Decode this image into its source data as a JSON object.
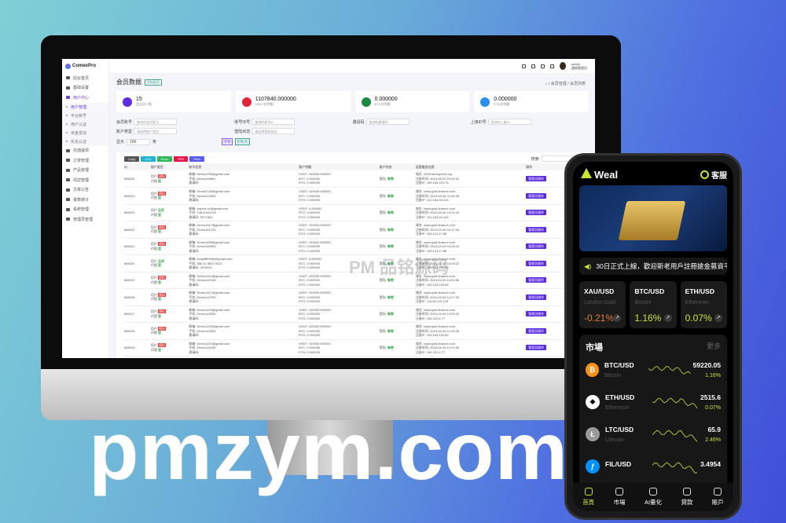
{
  "watermark": "pmzym.com",
  "admin": {
    "logo": "ComexPro",
    "sidebar": [
      {
        "label": "后台首页"
      },
      {
        "label": "基础设置"
      },
      {
        "label": "用户中心",
        "active": true,
        "children": [
          "用户管理",
          "平台账号",
          "用户认证",
          "资金变动",
          "实名认证"
        ]
      },
      {
        "label": "充值提现"
      },
      {
        "label": "订单管理"
      },
      {
        "label": "产品管理"
      },
      {
        "label": "风控管理"
      },
      {
        "label": "文章公告"
      },
      {
        "label": "报表统计"
      },
      {
        "label": "系统管理"
      },
      {
        "label": "管理员管理"
      }
    ],
    "user": {
      "name": "admin",
      "role": "超级管理员"
    },
    "title": "会员数据",
    "title_tag": "添加会员",
    "breadcrumb": [
      "会员管理",
      "会员列表"
    ],
    "cards": [
      {
        "value": "15",
        "label": "会员总人数",
        "color": "#5b2be0",
        "icon": "users-icon"
      },
      {
        "value": "1107840.000000",
        "label": "USDT总余额",
        "color": "#e0243a",
        "icon": "wallet-icon"
      },
      {
        "value": "0.000000",
        "label": "BTC总余额",
        "color": "#1a8a40",
        "icon": "bitcoin-icon"
      },
      {
        "value": "0.000000",
        "label": "ETH总余额",
        "color": "#2a8ff0",
        "icon": "diamond-icon"
      }
    ],
    "filters": [
      {
        "label": "会员账号",
        "placeholder": "查询的会员账号"
      },
      {
        "label": "账号ID号",
        "placeholder": "查询的账号ID"
      },
      {
        "label": "邀请码",
        "placeholder": "查询的邀请码"
      },
      {
        "label": "上级ID号",
        "placeholder": "查询的上级ID"
      },
      {
        "label": "账户类型",
        "placeholder": "请选择账户类型"
      },
      {
        "label": "登陆状态",
        "placeholder": "请选择登陆状态"
      }
    ],
    "show_label": "显示",
    "page_size": "100",
    "page_unit": "条",
    "search_btn": "搜索",
    "reset_btn": "初始化",
    "export_buttons": [
      {
        "label": "Copy",
        "color": "#555"
      },
      {
        "label": "CSV",
        "color": "#1fb5d0"
      },
      {
        "label": "Excel",
        "color": "#2eb85c"
      },
      {
        "label": "PDF",
        "color": "#e8154b"
      },
      {
        "label": "Print",
        "color": "#5a5af0"
      }
    ],
    "search_label": "搜索:",
    "columns": [
      "ID",
      "账户类型",
      "账号信息",
      "账户余额",
      "账户状态",
      "运营服务信息",
      "操作"
    ],
    "rows": [
      {
        "id": "866025",
        "type": "模拟",
        "agent": "否",
        "email": "Demo1936@gmail.com",
        "phone": "Demo193651",
        "invite": "",
        "usdt": "100000.000000",
        "btc": "0.000000",
        "eth": "0.000000",
        "status": "有效",
        "site": "403h.tarwayin18.top",
        "time": "2024-05-03 19:26:51",
        "ip": "159.150.222.76"
      },
      {
        "id": "866024",
        "type": "模拟",
        "agent": "否",
        "email": "Demo2145@gmail.com",
        "phone": "Demo214526",
        "invite": "",
        "usdt": "100000.000000",
        "btc": "0.000000",
        "eth": "0.000000",
        "status": "有效",
        "site": "www.gold-finance.com",
        "time": "2024-04-04 21:45:35",
        "ip": "141.164.94.124"
      },
      {
        "id": "866023",
        "type": "正式",
        "agent": "否",
        "email": "wsplus.cc@gmail.com",
        "phone": "13812341234",
        "invite": "P572463",
        "usdt": "0.000000",
        "btc": "0.000000",
        "eth": "0.000000",
        "status": "有效",
        "site": "www.gold-finance.com",
        "time": "2024-04-04 19:24:44",
        "ip": "141.164.94.124"
      },
      {
        "id": "866022",
        "type": "模拟",
        "agent": "否",
        "email": "Demo1617@gmail.com",
        "phone": "Demo161743",
        "invite": "",
        "usdt": "100000.000000",
        "btc": "0.000000",
        "eth": "0.000000",
        "status": "有效",
        "site": "www.gold-finance.com",
        "time": "2024-04-04 16:17:43",
        "ip": "153.141.17.86"
      },
      {
        "id": "866021",
        "type": "模拟",
        "agent": "否",
        "email": "Demo1605@gmail.com",
        "phone": "Demo160503",
        "invite": "",
        "usdt": "100000.000000",
        "btc": "0.000000",
        "eth": "0.000000",
        "status": "有效",
        "site": "www.gold-finance.com",
        "time": "2024-04-04 16:05:03",
        "ip": "153.141.17.86"
      },
      {
        "id": "866020",
        "type": "正式",
        "agent": "否",
        "email": "lucy6880565@gmail.com",
        "phone": "856 20 9820 5420",
        "invite": "J875311",
        "usdt": "0.000000",
        "btc": "0.000000",
        "eth": "0.000000",
        "status": "有效",
        "site": "www.gold-finance.com",
        "time": "2024-04-04 15:03:22",
        "ip": "153.153.153.66"
      },
      {
        "id": "866019",
        "type": "模拟",
        "agent": "否",
        "email": "Demo1421@gmail.com",
        "phone": "Demo142158",
        "invite": "",
        "usdt": "100000.000000",
        "btc": "0.000000",
        "eth": "0.000000",
        "status": "有效",
        "site": "www.gold-finance.com",
        "time": "2024-04-04 14:21:58",
        "ip": "153.153.153.66"
      },
      {
        "id": "866018",
        "type": "模拟",
        "agent": "否",
        "email": "Demo1427@gmail.com",
        "phone": "Demo142753",
        "invite": "",
        "usdt": "100000.000000",
        "btc": "0.000000",
        "eth": "0.000000",
        "status": "有效",
        "site": "www.gold-finance.com",
        "time": "2024-04-04 14:27:53",
        "ip": "115.84.119.128"
      },
      {
        "id": "866017",
        "type": "模拟",
        "agent": "否",
        "email": "Demo1425@gmail.com",
        "phone": "Demo142530",
        "invite": "",
        "usdt": "100000.000000",
        "btc": "0.000000",
        "eth": "0.000000",
        "status": "有效",
        "site": "www.gold-finance.com",
        "time": "2024-04-04 14:25:30",
        "ip": "154.222.4.77"
      },
      {
        "id": "866016",
        "type": "模拟",
        "agent": "否",
        "email": "Demo1425@gmail.com",
        "phone": "Demo142526",
        "invite": "",
        "usdt": "100000.000000",
        "btc": "0.000000",
        "eth": "0.000000",
        "status": "有效",
        "site": "www.gold-finance.com",
        "time": "2024-04-04 14:25:26",
        "ip": "153.153.153.66"
      },
      {
        "id": "866015",
        "type": "模拟",
        "agent": "否",
        "email": "Demo1421@gmail.com",
        "phone": "Demo142155",
        "invite": "",
        "usdt": "100000.000000",
        "btc": "0.000000",
        "eth": "0.000000",
        "status": "有效",
        "site": "www.gold-finance.com",
        "time": "2024-04-04 14:21:55",
        "ip": "154.222.4.77"
      }
    ],
    "row_labels": {
      "user": "用户",
      "agent": "代理",
      "email": "邮箱:",
      "phone": "手机:",
      "invite": "邀请码:",
      "usdt": "USDT:",
      "btc": "BTC:",
      "eth": "ETH:",
      "status": "登陆:",
      "site": "域名:",
      "time": "注册时间:",
      "ip": "注册IP:"
    },
    "op_label": "管理员操作"
  },
  "phone": {
    "brand": "Weal",
    "service": "客服",
    "notice": "30日正式上線，歡迎新老用戶註冊搶金募資平臺",
    "tiles": [
      {
        "pair": "XAU/USD",
        "name": "London Gold",
        "change": "-0.21%",
        "color": "#e07a3a"
      },
      {
        "pair": "BTC/USD",
        "name": "Bitcoin",
        "change": "1.16%",
        "color": "#c6e63a"
      },
      {
        "pair": "ETH/USD",
        "name": "Ethereum",
        "change": "0.07%",
        "color": "#c6e63a"
      }
    ],
    "market_title": "市場",
    "more": "更多",
    "market": [
      {
        "pair": "BTC/USD",
        "name": "Bitcoin",
        "price": "59220.05",
        "change": "1.16%",
        "color": "#f7931a",
        "glyph": "₿"
      },
      {
        "pair": "ETH/USD",
        "name": "Ethereum",
        "price": "2515.6",
        "change": "0.07%",
        "color": "#ffffff",
        "glyph": "◆"
      },
      {
        "pair": "LTC/USD",
        "name": "Litecoin",
        "price": "65.9",
        "change": "2.46%",
        "color": "#999999",
        "glyph": "Ł"
      },
      {
        "pair": "FIL/USD",
        "name": "",
        "price": "3.4954",
        "change": "",
        "color": "#0090ff",
        "glyph": "ƒ"
      }
    ],
    "nav": [
      "首頁",
      "市場",
      "AI量化",
      "貸款",
      "賬戶"
    ]
  }
}
